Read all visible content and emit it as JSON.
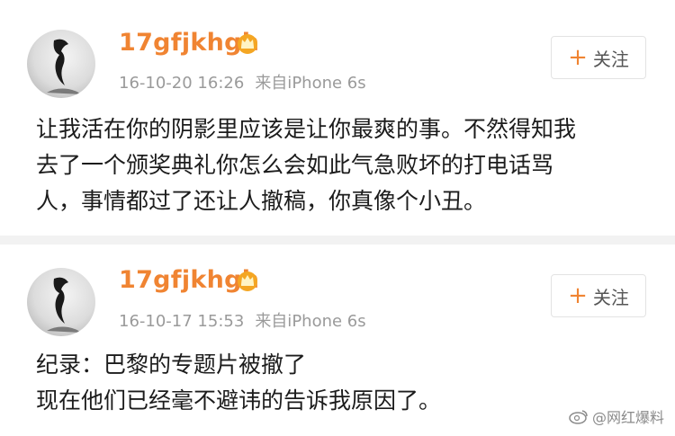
{
  "posts": [
    {
      "username": "17gfjkhgh",
      "time": "16-10-20 16:26",
      "source": "来自iPhone 6s",
      "follow_label": "关注",
      "follow_plus": "+",
      "lines": [
        "让我活在你的阴影里应该是让你最爽的事。不然得知我",
        "去了一个颁奖典礼你怎么会如此气急败坏的打电话骂",
        "人，事情都过了还让人撤稿，你真像个小丑。"
      ]
    },
    {
      "username": "17gfjkhgh",
      "time": "16-10-17 15:53",
      "source": "来自iPhone 6s",
      "follow_label": "关注",
      "follow_plus": "+",
      "lines": [
        "纪录：巴黎的专题片被撤了",
        "现在他们已经毫不避讳的告诉我原因了。"
      ]
    }
  ],
  "watermark": {
    "text": "@网红爆料"
  },
  "colors": {
    "username": "#f08432",
    "meta": "#9a9a9a",
    "separator": "#f2f2f2"
  },
  "icons": {
    "avatar": "avatar-image",
    "vip": "crown-vip-icon",
    "watermark": "weibo-logo-icon"
  }
}
